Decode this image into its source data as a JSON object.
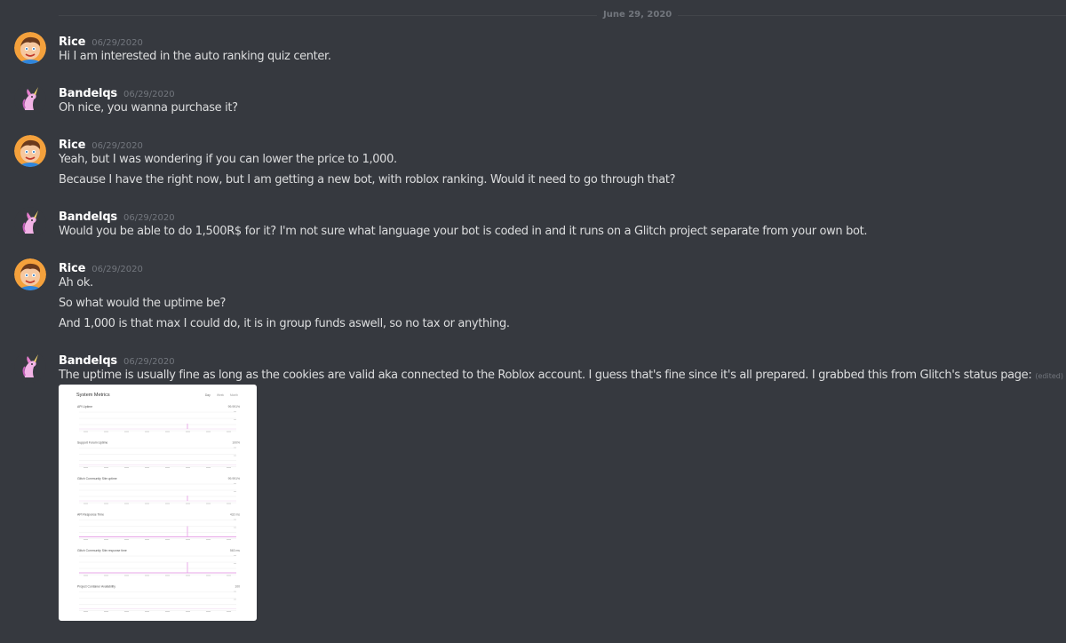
{
  "date_divider": "June 29, 2020",
  "messages": [
    {
      "author": "Rice",
      "timestamp": "06/29/2020",
      "avatar": "cartoon-boy-avatar",
      "lines": [
        "Hi I am interested in the auto ranking quiz center."
      ]
    },
    {
      "author": "Bandelqs",
      "timestamp": "06/29/2020",
      "avatar": "pink-unicorn-avatar",
      "lines": [
        "Oh nice, you wanna purchase it?"
      ]
    },
    {
      "author": "Rice",
      "timestamp": "06/29/2020",
      "avatar": "cartoon-boy-avatar",
      "lines": [
        "Yeah, but I was wondering if you can lower the price to 1,000.",
        "Because I have the right now, but I am getting a new bot, with roblox ranking. Would it need to go through that?"
      ]
    },
    {
      "author": "Bandelqs",
      "timestamp": "06/29/2020",
      "avatar": "pink-unicorn-avatar",
      "lines": [
        "Would you be able to do 1,500R$ for it? I'm not sure what language your bot is coded in and it runs on a Glitch project separate from your own bot."
      ]
    },
    {
      "author": "Rice",
      "timestamp": "06/29/2020",
      "avatar": "cartoon-boy-avatar",
      "lines": [
        "Ah ok.",
        "So what would the uptime be?",
        "And 1,000 is that max I could do, it is in group funds aswell, so no tax or anything."
      ]
    },
    {
      "author": "Bandelqs",
      "timestamp": "06/29/2020",
      "avatar": "pink-unicorn-avatar",
      "lines": [
        "The uptime is usually fine as long as the cookies are valid aka connected to the Roblox account. I guess that's fine since it's all prepared. I grabbed this from Glitch's status page:"
      ],
      "edited": "(edited)"
    }
  ],
  "attachment": {
    "title": "System Metrics",
    "tabs": [
      "Day",
      "Week",
      "Month"
    ],
    "metrics": [
      {
        "label": "API Uptime",
        "value": "99.991%"
      },
      {
        "label": "Support Forum Uptime",
        "value": "100%"
      },
      {
        "label": "Glitch Community Site uptime",
        "value": "99.991%"
      },
      {
        "label": "API Response Time",
        "value": "432 ms"
      },
      {
        "label": "Glitch Community Site response time",
        "value": "563 ms"
      },
      {
        "label": "Project Container Availability",
        "value": "100"
      }
    ],
    "accent_color": "#e8a5e8"
  },
  "colors": {
    "background": "#36393f",
    "text": "#dcddde",
    "username": "#ffffff",
    "muted": "#72767d"
  }
}
